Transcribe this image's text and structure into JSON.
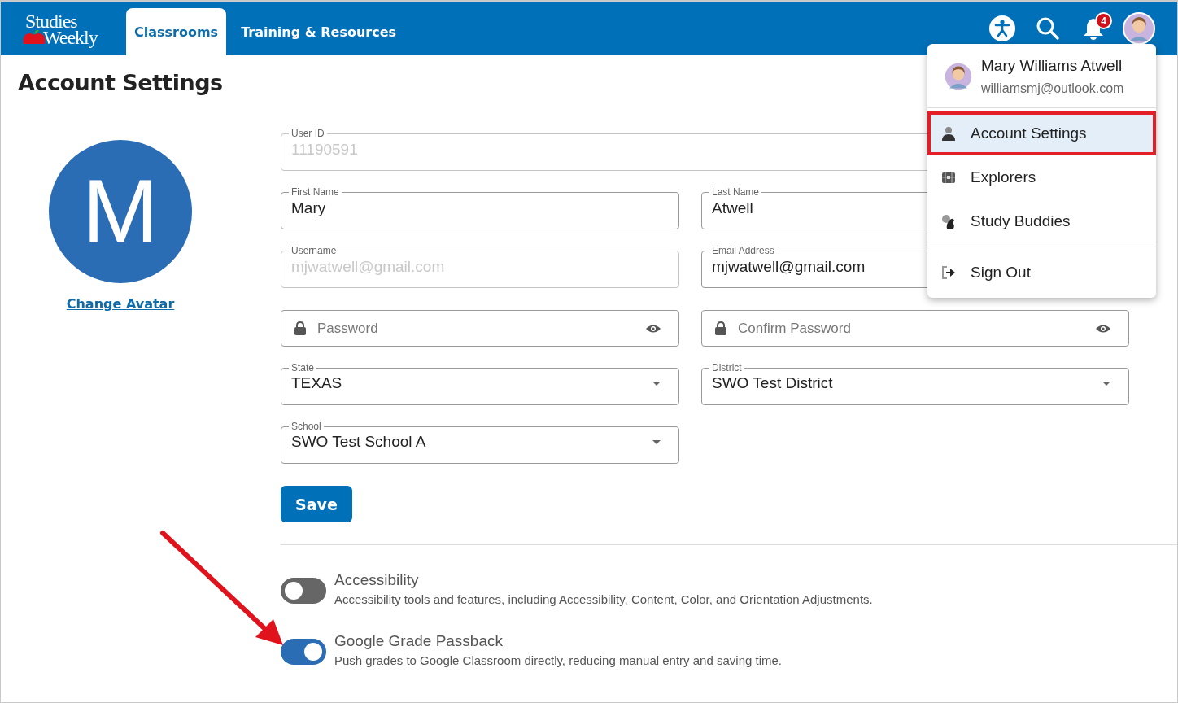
{
  "header": {
    "logo": {
      "line1": "Studies",
      "line2": "Weekly"
    },
    "tabs": [
      {
        "label": "Classrooms",
        "selected": true
      },
      {
        "label": "Training & Resources",
        "selected": false
      }
    ],
    "notification_count": "4"
  },
  "page": {
    "title": "Account Settings",
    "avatar_letter": "M",
    "avatar_link": "Change Avatar"
  },
  "form": {
    "rows": [
      [
        {
          "kind": "text",
          "label": "User ID",
          "value": "11190591",
          "disabled": true
        }
      ],
      [
        {
          "kind": "text",
          "label": "First Name",
          "value": "Mary",
          "disabled": false
        },
        {
          "kind": "text",
          "label": "Last Name",
          "value": "Atwell",
          "disabled": false
        }
      ],
      [
        {
          "kind": "text",
          "label": "Username",
          "value": "mjwatwell@gmail.com",
          "disabled": true
        },
        {
          "kind": "text",
          "label": "Email Address",
          "value": "mjwatwell@gmail.com",
          "disabled": false
        }
      ],
      [
        {
          "kind": "password",
          "placeholder": "Password"
        },
        {
          "kind": "password",
          "placeholder": "Confirm Password"
        }
      ],
      [
        {
          "kind": "select",
          "label": "State",
          "value": "TEXAS"
        },
        {
          "kind": "select",
          "label": "District",
          "value": "SWO Test District"
        }
      ],
      [
        {
          "kind": "select",
          "label": "School",
          "value": "SWO Test School A"
        }
      ]
    ],
    "save_button": "Save"
  },
  "toggles": [
    {
      "title": "Accessibility",
      "description": "Accessibility tools and features, including Accessibility, Content, Color, and Orientation Adjustments.",
      "on": false
    },
    {
      "title": "Google Grade Passback",
      "description": "Push grades to Google Classroom directly, reducing manual entry and saving time.",
      "on": true
    }
  ],
  "user_menu": {
    "name": "Mary Williams Atwell",
    "email": "williamsmj@outlook.com",
    "sections": [
      [
        {
          "label": "Account Settings",
          "selected": true,
          "highlighted": true
        },
        {
          "label": "Explorers",
          "selected": false,
          "highlighted": false
        },
        {
          "label": "Study Buddies",
          "selected": false,
          "highlighted": false
        }
      ],
      [
        {
          "label": "Sign Out",
          "selected": false,
          "highlighted": false
        }
      ]
    ]
  }
}
